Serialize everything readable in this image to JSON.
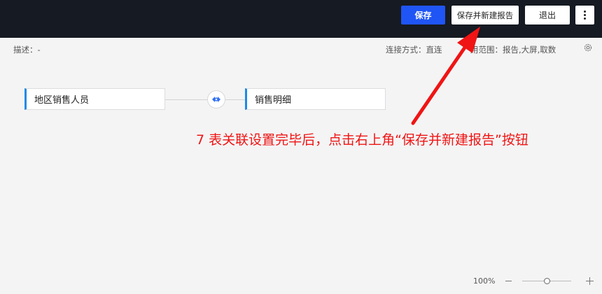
{
  "toolbar": {
    "save_label": "保存",
    "save_new_report_label": "保存并新建报告",
    "exit_label": "退出",
    "more_icon": "more-vertical-icon"
  },
  "info": {
    "description": "描述：-",
    "connection": "连接方式：直连",
    "scope": "用范围：报告,大屏,取数",
    "settings_icon": "gear-icon"
  },
  "canvas": {
    "nodes": [
      {
        "label": "地区销售人员"
      },
      {
        "label": "销售明细"
      }
    ],
    "join_icon": "link-icon"
  },
  "annotation": {
    "text": "7 表关联设置完毕后，点击右上角“保存并新建报告”按钮",
    "color": "#f01414"
  },
  "zoom": {
    "level": "100%"
  },
  "colors": {
    "topbar": "#161a22",
    "primary": "#1f55f5",
    "node_accent": "#1f8ae6"
  }
}
